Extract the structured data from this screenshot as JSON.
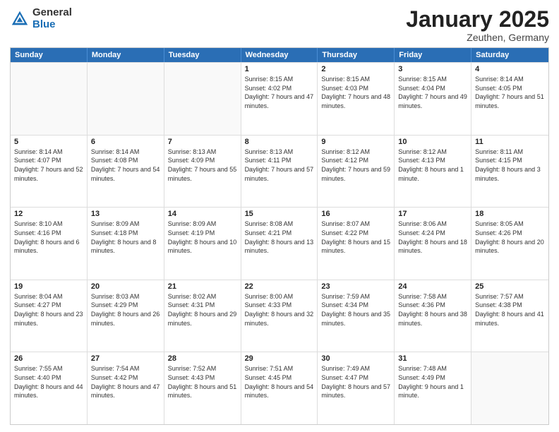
{
  "logo": {
    "general": "General",
    "blue": "Blue"
  },
  "title": "January 2025",
  "subtitle": "Zeuthen, Germany",
  "days": [
    "Sunday",
    "Monday",
    "Tuesday",
    "Wednesday",
    "Thursday",
    "Friday",
    "Saturday"
  ],
  "rows": [
    [
      {
        "num": "",
        "info": ""
      },
      {
        "num": "",
        "info": ""
      },
      {
        "num": "",
        "info": ""
      },
      {
        "num": "1",
        "info": "Sunrise: 8:15 AM\nSunset: 4:02 PM\nDaylight: 7 hours and 47 minutes."
      },
      {
        "num": "2",
        "info": "Sunrise: 8:15 AM\nSunset: 4:03 PM\nDaylight: 7 hours and 48 minutes."
      },
      {
        "num": "3",
        "info": "Sunrise: 8:15 AM\nSunset: 4:04 PM\nDaylight: 7 hours and 49 minutes."
      },
      {
        "num": "4",
        "info": "Sunrise: 8:14 AM\nSunset: 4:05 PM\nDaylight: 7 hours and 51 minutes."
      }
    ],
    [
      {
        "num": "5",
        "info": "Sunrise: 8:14 AM\nSunset: 4:07 PM\nDaylight: 7 hours and 52 minutes."
      },
      {
        "num": "6",
        "info": "Sunrise: 8:14 AM\nSunset: 4:08 PM\nDaylight: 7 hours and 54 minutes."
      },
      {
        "num": "7",
        "info": "Sunrise: 8:13 AM\nSunset: 4:09 PM\nDaylight: 7 hours and 55 minutes."
      },
      {
        "num": "8",
        "info": "Sunrise: 8:13 AM\nSunset: 4:11 PM\nDaylight: 7 hours and 57 minutes."
      },
      {
        "num": "9",
        "info": "Sunrise: 8:12 AM\nSunset: 4:12 PM\nDaylight: 7 hours and 59 minutes."
      },
      {
        "num": "10",
        "info": "Sunrise: 8:12 AM\nSunset: 4:13 PM\nDaylight: 8 hours and 1 minute."
      },
      {
        "num": "11",
        "info": "Sunrise: 8:11 AM\nSunset: 4:15 PM\nDaylight: 8 hours and 3 minutes."
      }
    ],
    [
      {
        "num": "12",
        "info": "Sunrise: 8:10 AM\nSunset: 4:16 PM\nDaylight: 8 hours and 6 minutes."
      },
      {
        "num": "13",
        "info": "Sunrise: 8:09 AM\nSunset: 4:18 PM\nDaylight: 8 hours and 8 minutes."
      },
      {
        "num": "14",
        "info": "Sunrise: 8:09 AM\nSunset: 4:19 PM\nDaylight: 8 hours and 10 minutes."
      },
      {
        "num": "15",
        "info": "Sunrise: 8:08 AM\nSunset: 4:21 PM\nDaylight: 8 hours and 13 minutes."
      },
      {
        "num": "16",
        "info": "Sunrise: 8:07 AM\nSunset: 4:22 PM\nDaylight: 8 hours and 15 minutes."
      },
      {
        "num": "17",
        "info": "Sunrise: 8:06 AM\nSunset: 4:24 PM\nDaylight: 8 hours and 18 minutes."
      },
      {
        "num": "18",
        "info": "Sunrise: 8:05 AM\nSunset: 4:26 PM\nDaylight: 8 hours and 20 minutes."
      }
    ],
    [
      {
        "num": "19",
        "info": "Sunrise: 8:04 AM\nSunset: 4:27 PM\nDaylight: 8 hours and 23 minutes."
      },
      {
        "num": "20",
        "info": "Sunrise: 8:03 AM\nSunset: 4:29 PM\nDaylight: 8 hours and 26 minutes."
      },
      {
        "num": "21",
        "info": "Sunrise: 8:02 AM\nSunset: 4:31 PM\nDaylight: 8 hours and 29 minutes."
      },
      {
        "num": "22",
        "info": "Sunrise: 8:00 AM\nSunset: 4:33 PM\nDaylight: 8 hours and 32 minutes."
      },
      {
        "num": "23",
        "info": "Sunrise: 7:59 AM\nSunset: 4:34 PM\nDaylight: 8 hours and 35 minutes."
      },
      {
        "num": "24",
        "info": "Sunrise: 7:58 AM\nSunset: 4:36 PM\nDaylight: 8 hours and 38 minutes."
      },
      {
        "num": "25",
        "info": "Sunrise: 7:57 AM\nSunset: 4:38 PM\nDaylight: 8 hours and 41 minutes."
      }
    ],
    [
      {
        "num": "26",
        "info": "Sunrise: 7:55 AM\nSunset: 4:40 PM\nDaylight: 8 hours and 44 minutes."
      },
      {
        "num": "27",
        "info": "Sunrise: 7:54 AM\nSunset: 4:42 PM\nDaylight: 8 hours and 47 minutes."
      },
      {
        "num": "28",
        "info": "Sunrise: 7:52 AM\nSunset: 4:43 PM\nDaylight: 8 hours and 51 minutes."
      },
      {
        "num": "29",
        "info": "Sunrise: 7:51 AM\nSunset: 4:45 PM\nDaylight: 8 hours and 54 minutes."
      },
      {
        "num": "30",
        "info": "Sunrise: 7:49 AM\nSunset: 4:47 PM\nDaylight: 8 hours and 57 minutes."
      },
      {
        "num": "31",
        "info": "Sunrise: 7:48 AM\nSunset: 4:49 PM\nDaylight: 9 hours and 1 minute."
      },
      {
        "num": "",
        "info": ""
      }
    ]
  ]
}
